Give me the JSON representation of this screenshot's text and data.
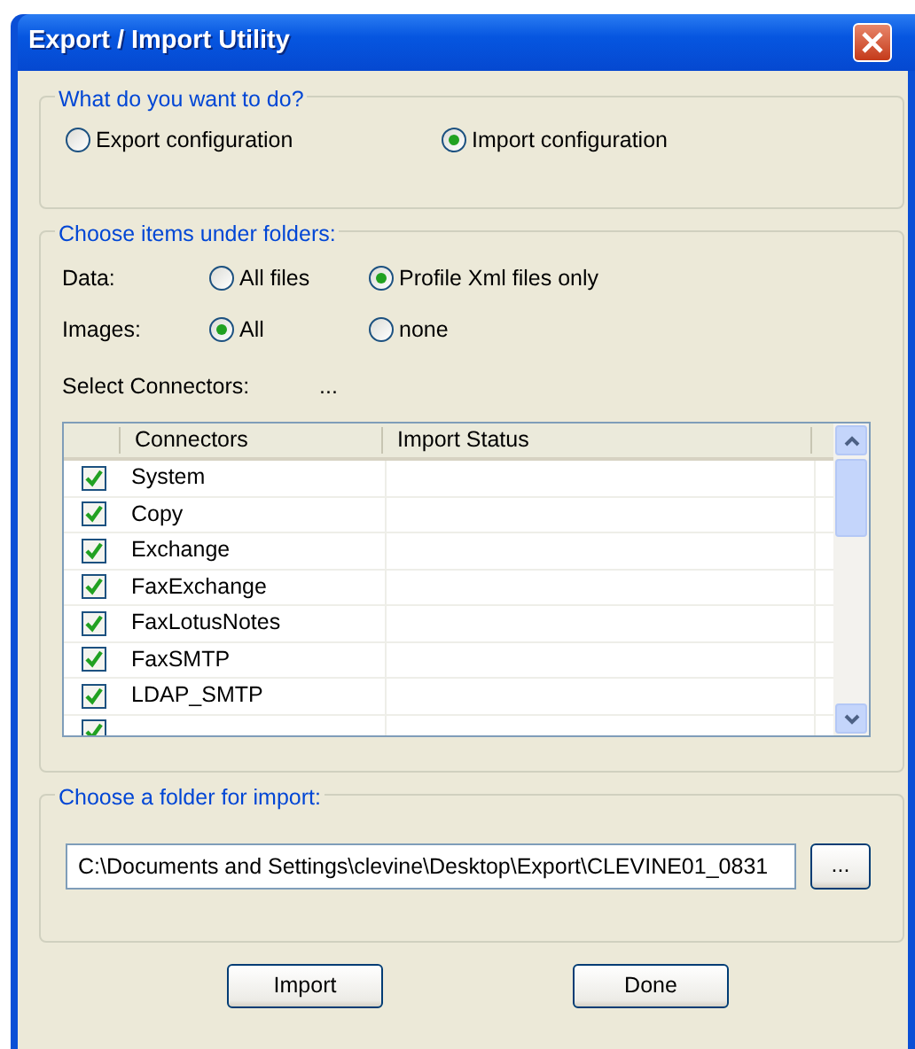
{
  "window": {
    "title": "Export / Import Utility"
  },
  "action_group": {
    "legend": "What do you want to do?",
    "options": [
      {
        "label": "Export configuration",
        "selected": false
      },
      {
        "label": "Import configuration",
        "selected": true
      }
    ]
  },
  "items_group": {
    "legend": "Choose items under folders:",
    "data": {
      "label": "Data:",
      "options": [
        {
          "label": "All files",
          "selected": false
        },
        {
          "label": "Profile Xml files only",
          "selected": true
        }
      ]
    },
    "images": {
      "label": "Images:",
      "options": [
        {
          "label": "All",
          "selected": true
        },
        {
          "label": "none",
          "selected": false
        }
      ]
    },
    "select_connectors": {
      "label": "Select Connectors:",
      "value": "..."
    },
    "table": {
      "columns": [
        "Connectors",
        "Import Status"
      ],
      "rows": [
        {
          "name": "System",
          "checked": true
        },
        {
          "name": "Copy",
          "checked": true
        },
        {
          "name": "Exchange",
          "checked": true
        },
        {
          "name": "FaxExchange",
          "checked": true
        },
        {
          "name": "FaxLotusNotes",
          "checked": true
        },
        {
          "name": "FaxSMTP",
          "checked": true
        },
        {
          "name": "LDAP_SMTP",
          "checked": true
        },
        {
          "checked": true
        }
      ]
    }
  },
  "folder_group": {
    "legend": "Choose a folder for import:",
    "path": "C:\\Documents and Settings\\clevine\\Desktop\\Export\\CLEVINE01_0831",
    "browse": "..."
  },
  "buttons": [
    "Import",
    "Done"
  ]
}
